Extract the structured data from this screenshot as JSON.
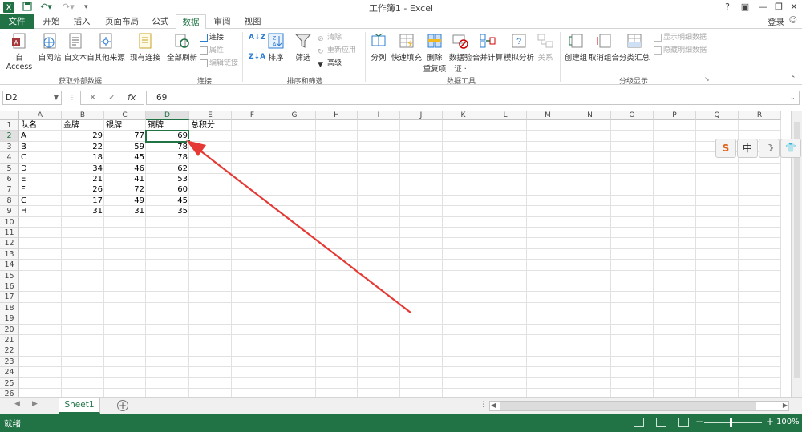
{
  "window": {
    "title": "工作簿1 - Excel",
    "help": "?",
    "login": "登录"
  },
  "tabs": [
    "文件",
    "开始",
    "插入",
    "页面布局",
    "公式",
    "数据",
    "审阅",
    "视图"
  ],
  "ribbon": {
    "external": {
      "access": "自 Access",
      "web": "自网站",
      "text": "自文本",
      "other": "自其他来源",
      "existing": "现有连接",
      "label": "获取外部数据"
    },
    "connections": {
      "refresh": "全部刷新",
      "connect": "连接",
      "props": "属性",
      "edit_links": "编辑链接",
      "label": "连接"
    },
    "sort": {
      "sort": "排序",
      "filter": "筛选",
      "clear": "清除",
      "reapply": "重新应用",
      "advanced": "高级",
      "label": "排序和筛选"
    },
    "tools": {
      "split": "分列",
      "flash": "快速填充",
      "remove_dup_1": "删除",
      "remove_dup_2": "重复项",
      "validate_1": "数据验",
      "validate_2": "证 ·",
      "consolidate": "合并计算",
      "whatif": "模拟分析",
      "relations": "关系",
      "label": "数据工具"
    },
    "outline": {
      "group": "创建组",
      "ungroup": "取消组合",
      "subtotal": "分类汇总",
      "show_detail": "显示明细数据",
      "hide_detail": "隐藏明细数据",
      "label": "分级显示"
    }
  },
  "formula_bar": {
    "name_box": "D2",
    "cancel": "✕",
    "enter": "✓",
    "fx": "fx",
    "value": "69"
  },
  "columns": [
    "A",
    "B",
    "C",
    "D",
    "E",
    "F",
    "G",
    "H",
    "I",
    "J",
    "K",
    "L",
    "M",
    "N",
    "O",
    "P",
    "Q",
    "R"
  ],
  "rows": [
    "1",
    "2",
    "3",
    "4",
    "5",
    "6",
    "7",
    "8",
    "9",
    "10",
    "11",
    "12",
    "13",
    "14",
    "15",
    "16",
    "17",
    "18",
    "19",
    "20",
    "21",
    "22",
    "23",
    "24",
    "25",
    "26"
  ],
  "table": {
    "headers": [
      "队名",
      "金牌",
      "银牌",
      "铜牌",
      "总积分"
    ],
    "data": [
      [
        "A",
        "29",
        "77",
        "69"
      ],
      [
        "B",
        "22",
        "59",
        "78"
      ],
      [
        "C",
        "18",
        "45",
        "78"
      ],
      [
        "D",
        "34",
        "46",
        "62"
      ],
      [
        "E",
        "21",
        "41",
        "53"
      ],
      [
        "F",
        "26",
        "72",
        "60"
      ],
      [
        "G",
        "17",
        "49",
        "45"
      ],
      [
        "H",
        "31",
        "31",
        "35"
      ]
    ]
  },
  "ime": {
    "sogou": "S",
    "zh": "中",
    "moon": "☽",
    "shirt": "👕"
  },
  "sheet": {
    "name": "Sheet1",
    "add": "+"
  },
  "status": {
    "ready": "就绪",
    "zoom": "100%"
  },
  "colors": {
    "excel_green": "#217346",
    "arrow_red": "#e53935"
  }
}
